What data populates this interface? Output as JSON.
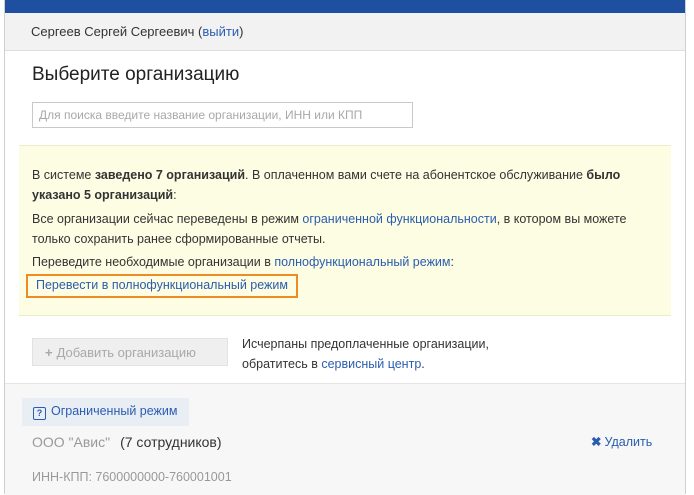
{
  "user": {
    "name": "Сергеев Сергей Сергеевич",
    "open_paren": " (",
    "logout": "выйти",
    "close_paren": ")"
  },
  "page_title": "Выберите организацию",
  "search": {
    "placeholder": "Для поиска введите название организации, ИНН или КПП",
    "value": ""
  },
  "notice": {
    "p1_a": "В системе ",
    "p1_b": "заведено 7 организаций",
    "p1_c": ". В оплаченном вами счете на абонентское обслуживание ",
    "p1_d": "было указано 5 организаций",
    "p1_e": ":",
    "p2_a": "Все организации сейчас переведены в режим ",
    "p2_link": "ограниченной функциональности",
    "p2_b": ", в котором вы можете только сохранить ранее сформированные отчеты.",
    "p3_a": "Переведите необходимые организации в ",
    "p3_link": "полнофункциональный режим",
    "p3_b": ":",
    "convert_button": "Перевести в полнофункциональный режим"
  },
  "add_button": {
    "plus": "+",
    "label": "Добавить организацию"
  },
  "exhausted": {
    "line1": "Исчерпаны предоплаченные организации,",
    "line2_a": "обратитесь в ",
    "line2_link": "сервисный центр",
    "line2_b": "."
  },
  "limited_mode": {
    "icon": "?",
    "label": "Ограниченный режим"
  },
  "organization": {
    "name": "ООО \"Авис\"",
    "employees": "(7 сотрудников)",
    "delete_icon": "✖",
    "delete_label": "Удалить",
    "inn_kpp": "ИНН-КПП: 7600000000-760001001"
  },
  "colors": {
    "brand_bar": "#1f4fa0",
    "link": "#2a5db0",
    "highlight": "#f08a24",
    "notice_bg": "#fdfde3"
  }
}
